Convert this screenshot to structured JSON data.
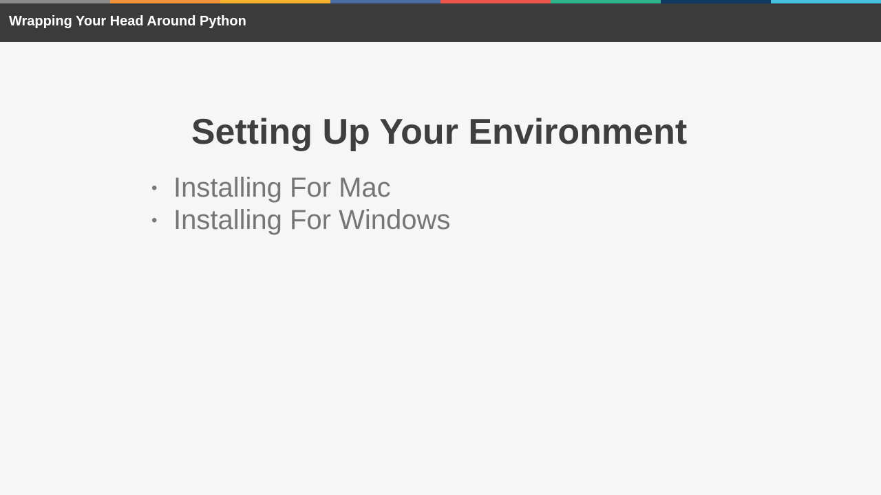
{
  "header": {
    "title": "Wrapping Your Head Around Python",
    "strip_colors": [
      "#8b8b8b",
      "#f2923a",
      "#f5b22f",
      "#4b6fa5",
      "#e9574a",
      "#2fb38b",
      "#10395f",
      "#45c1df"
    ],
    "background": "#3b3b3b"
  },
  "slide": {
    "heading": "Setting Up Your Environment",
    "bullets": [
      {
        "marker": "•",
        "text": "Installing For Mac"
      },
      {
        "marker": "•",
        "text": "Installing For Windows"
      }
    ],
    "background": "#f6f6f6"
  }
}
